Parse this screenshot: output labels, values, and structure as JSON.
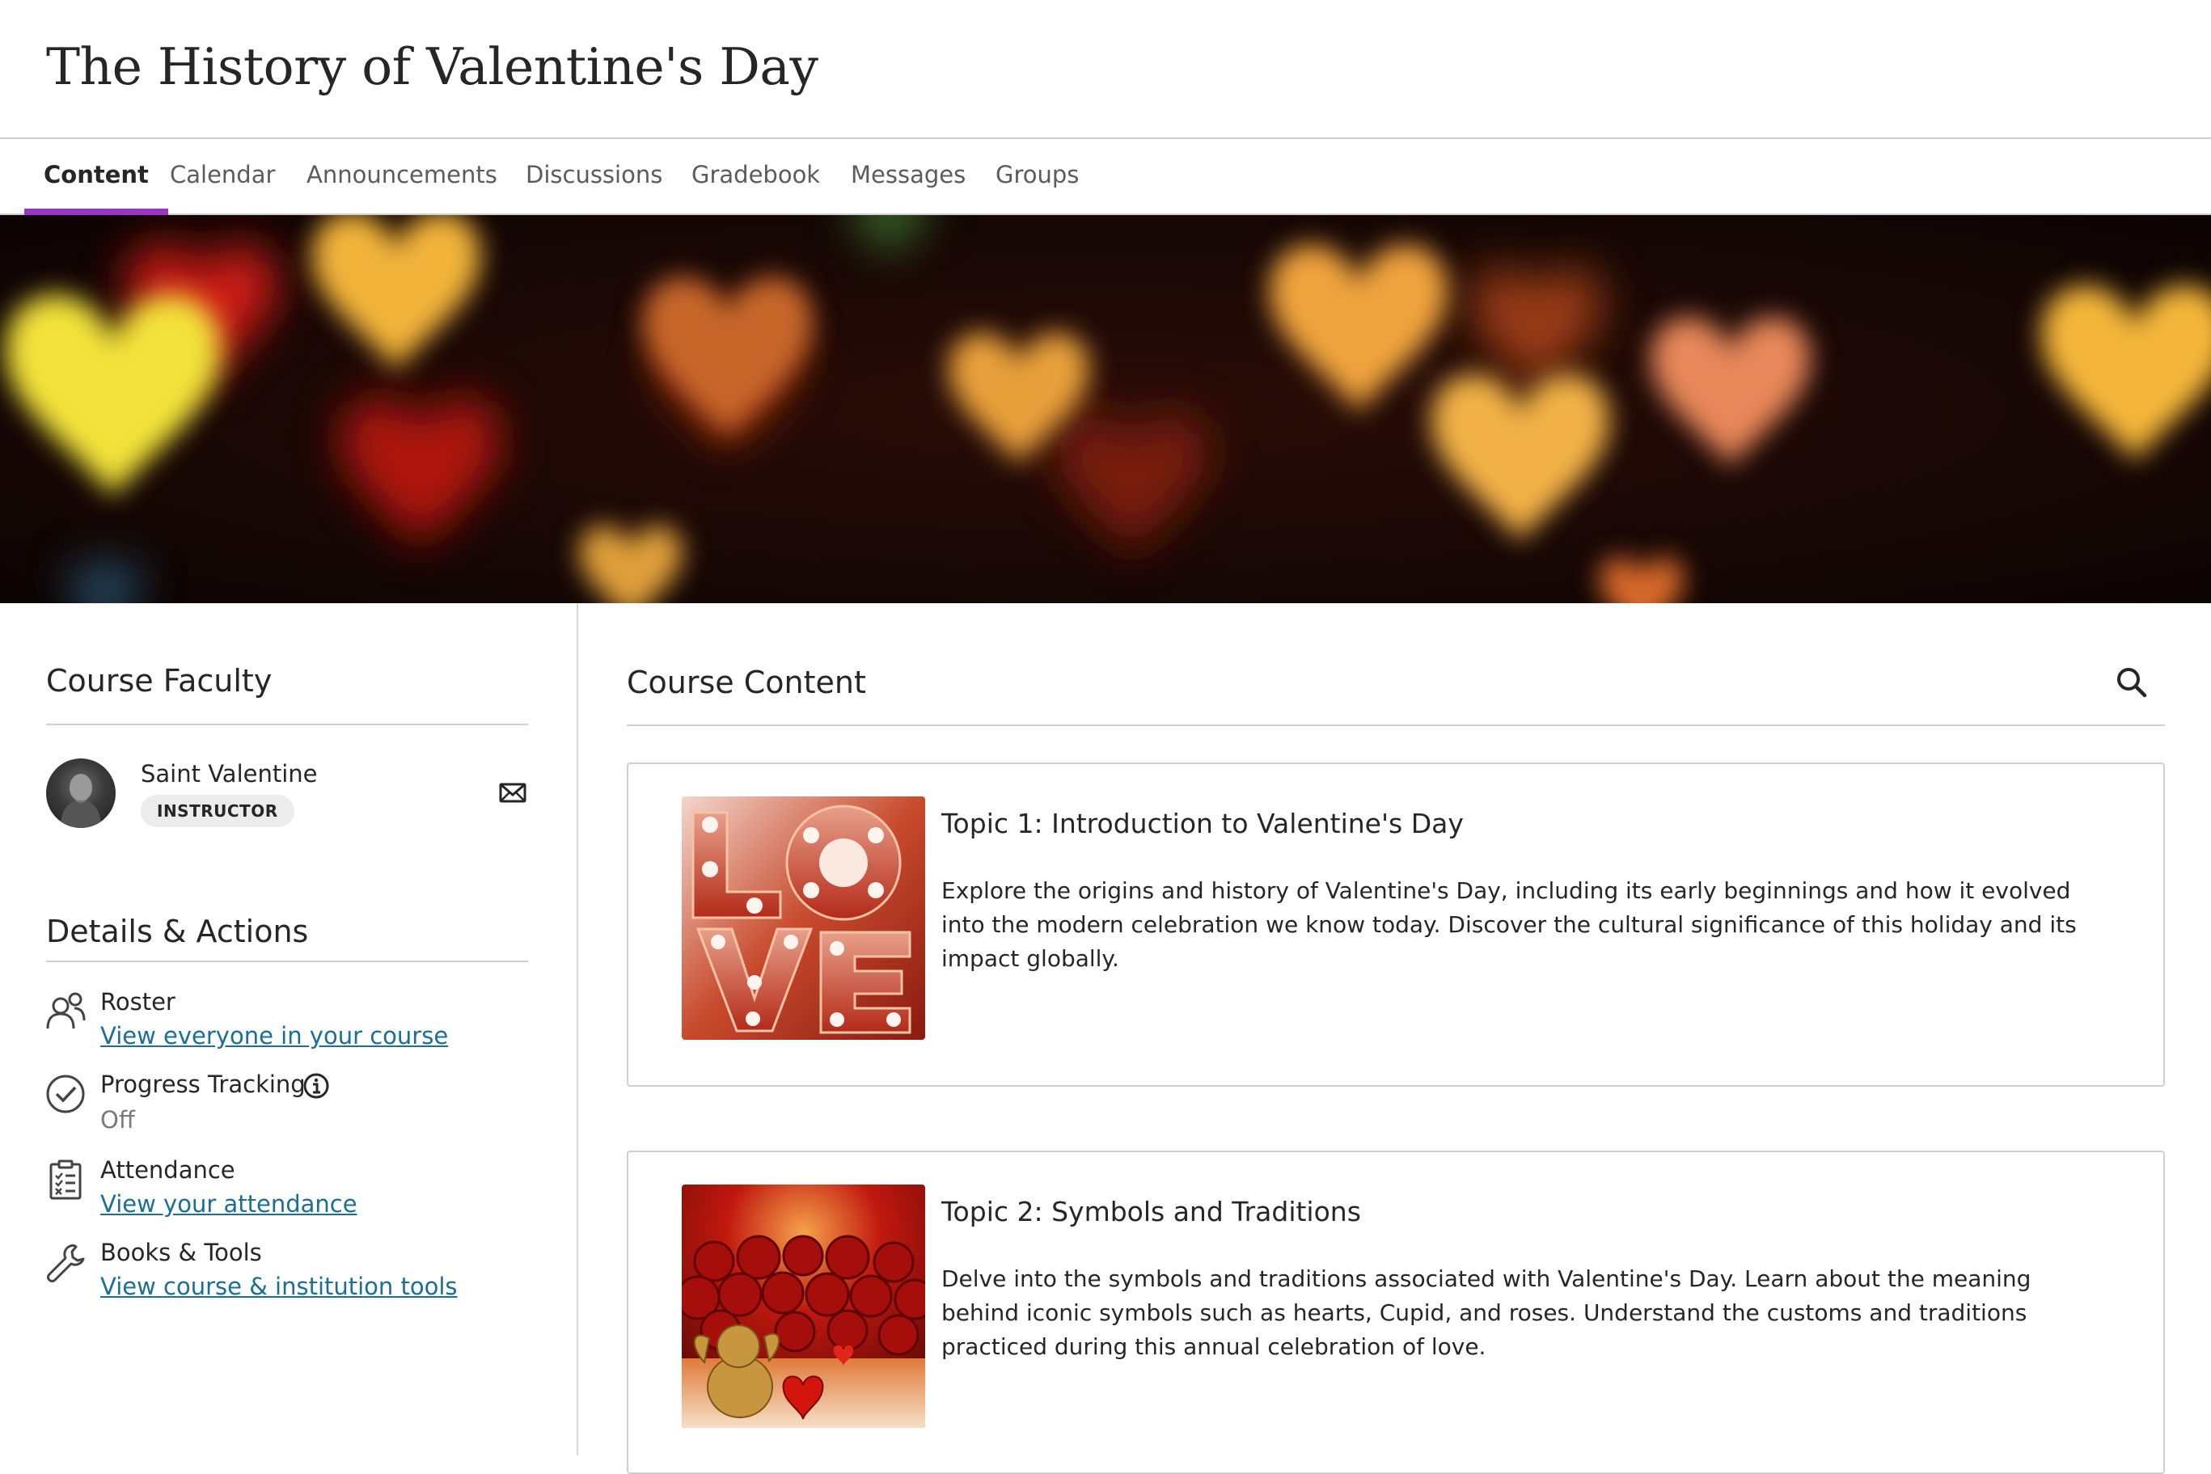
{
  "course": {
    "title": "The History of Valentine's Day"
  },
  "tabs": [
    {
      "label": "Content"
    },
    {
      "label": "Calendar"
    },
    {
      "label": "Announcements"
    },
    {
      "label": "Discussions"
    },
    {
      "label": "Gradebook"
    },
    {
      "label": "Messages"
    },
    {
      "label": "Groups"
    }
  ],
  "active_tab": "Content",
  "faculty": {
    "heading": "Course Faculty",
    "name": "Saint Valentine",
    "role": "INSTRUCTOR",
    "icon": "mail-icon"
  },
  "details": {
    "heading": "Details & Actions",
    "items": [
      {
        "title": "Roster",
        "link": "View everyone in your course",
        "icon": "roster-icon"
      },
      {
        "title": "Progress Tracking",
        "value": "Off",
        "icon": "check-circle-icon",
        "info_icon": "info-icon"
      },
      {
        "title": "Attendance",
        "link": "View your attendance",
        "icon": "clipboard-icon"
      },
      {
        "title": "Books & Tools",
        "link": "View course & institution tools",
        "icon": "wrench-icon"
      }
    ]
  },
  "content": {
    "heading": "Course Content",
    "search_icon": "search-icon",
    "items": [
      {
        "title": "Topic 1: Introduction to Valentine's Day",
        "description": "Explore the origins and history of Valentine's Day, including its early beginnings and how it evolved into the modern celebration we know today. Discover the cultural significance of this holiday and its impact globally."
      },
      {
        "title": "Topic 2: Symbols and Traditions",
        "description": "Delve into the symbols and traditions associated with Valentine's Day. Learn about the meaning behind iconic symbols such as hearts, Cupid, and roses. Understand the customs and traditions practiced during this annual celebration of love."
      }
    ]
  },
  "colors": {
    "accent": "#9b35c4",
    "link": "#1a6e97",
    "text": "#262626",
    "muted": "#7a7a7a",
    "border": "#cfcfcf"
  }
}
